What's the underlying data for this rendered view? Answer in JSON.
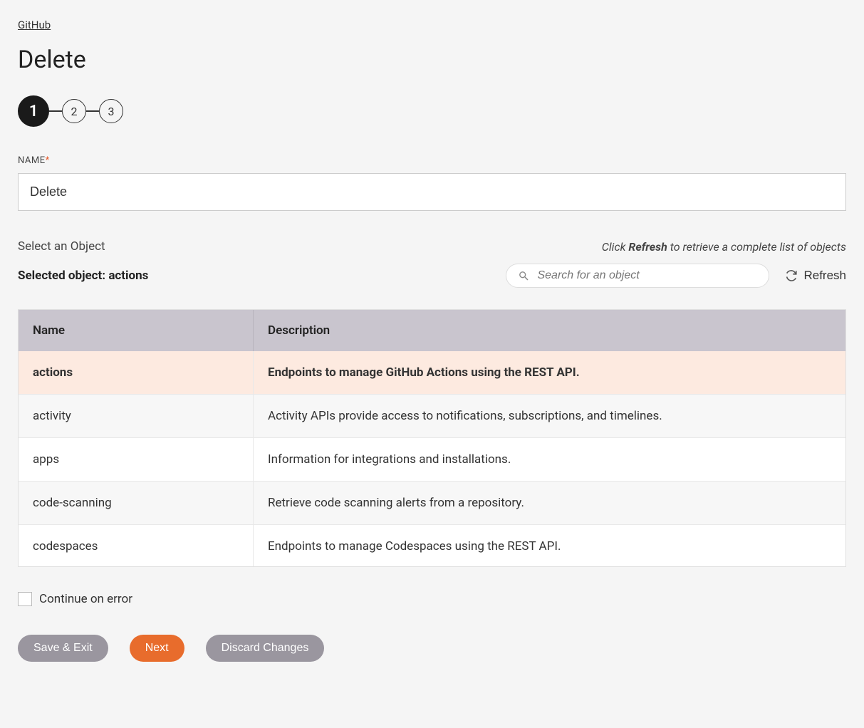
{
  "breadcrumb": "GitHub",
  "page_title": "Delete",
  "stepper": {
    "steps": [
      "1",
      "2",
      "3"
    ],
    "active_index": 0
  },
  "name_field": {
    "label": "NAME",
    "required_mark": "*",
    "value": "Delete"
  },
  "object_section": {
    "select_label": "Select an Object",
    "hint_prefix": "Click ",
    "hint_bold": "Refresh",
    "hint_suffix": " to retrieve a complete list of objects",
    "selected_prefix": "Selected object: ",
    "selected_value": "actions",
    "search_placeholder": "Search for an object",
    "refresh_label": "Refresh"
  },
  "table": {
    "headers": {
      "name": "Name",
      "description": "Description"
    },
    "rows": [
      {
        "name": "actions",
        "description": "Endpoints to manage GitHub Actions using the REST API.",
        "selected": true
      },
      {
        "name": "activity",
        "description": "Activity APIs provide access to notifications, subscriptions, and timelines.",
        "selected": false
      },
      {
        "name": "apps",
        "description": "Information for integrations and installations.",
        "selected": false
      },
      {
        "name": "code-scanning",
        "description": "Retrieve code scanning alerts from a repository.",
        "selected": false
      },
      {
        "name": "codespaces",
        "description": "Endpoints to manage Codespaces using the REST API.",
        "selected": false
      }
    ]
  },
  "continue_on_error_label": "Continue on error",
  "buttons": {
    "save_exit": "Save & Exit",
    "next": "Next",
    "discard": "Discard Changes"
  }
}
